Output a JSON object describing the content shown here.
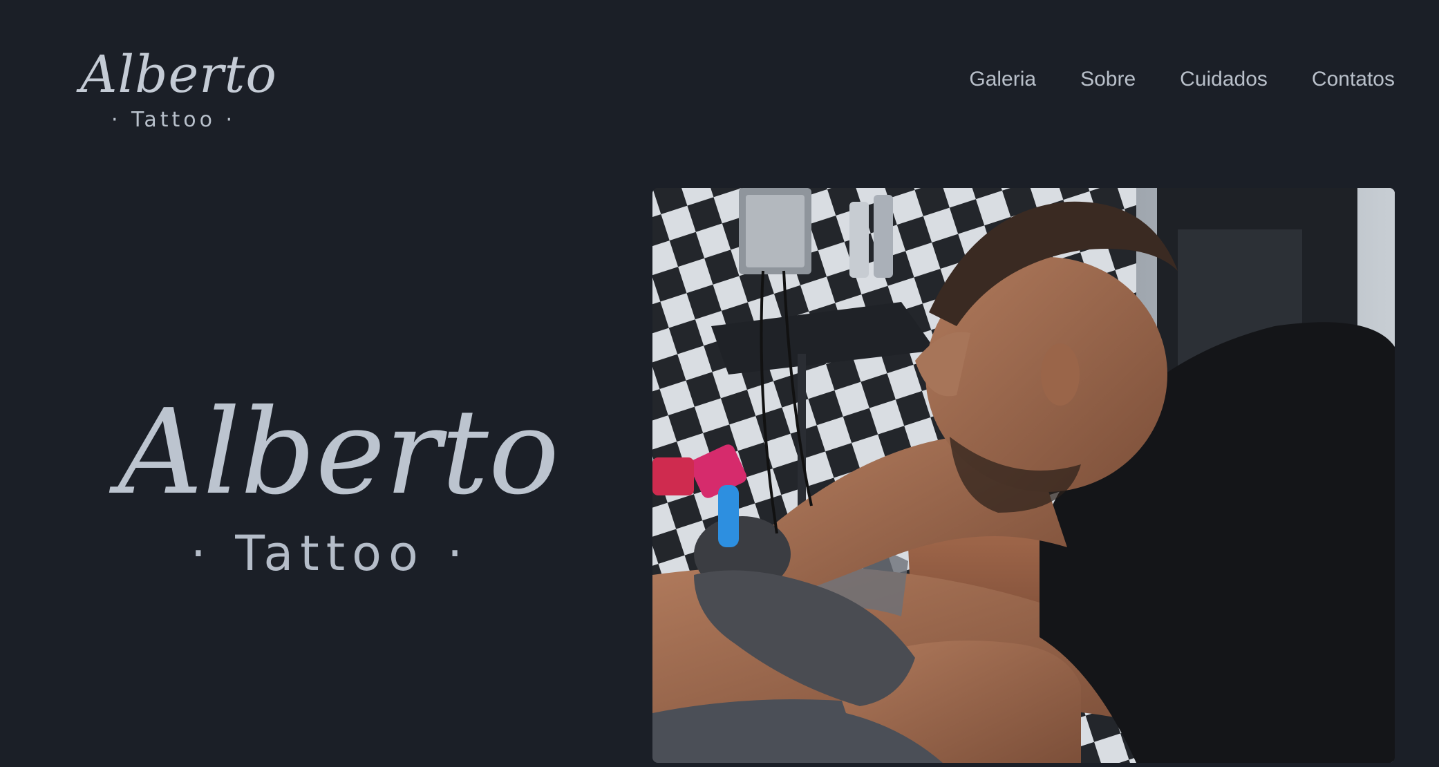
{
  "header": {
    "logo_script": "Alberto",
    "logo_sub": "· Tattoo ·"
  },
  "nav": {
    "items": [
      "Galeria",
      "Sobre",
      "Cuidados",
      "Contatos"
    ]
  },
  "hero": {
    "logo_script": "Alberto",
    "logo_sub": "· Tattoo ·"
  },
  "colors": {
    "background": "#1b1f27",
    "text": "#c4cbd5"
  }
}
